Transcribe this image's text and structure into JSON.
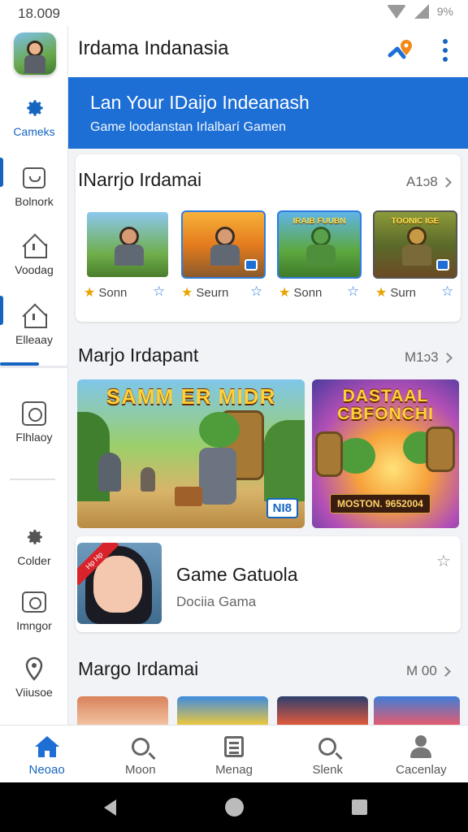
{
  "status": {
    "time": "18.009",
    "battery": "9%"
  },
  "app": {
    "title": "Irdama Indanasia"
  },
  "banner": {
    "title": "Lan Your IDaijo Indeanash",
    "subtitle": "Game loodanstan Irlalbarí Gamen"
  },
  "rail": {
    "items": [
      {
        "label": "Cameks",
        "icon": "gear-icon"
      },
      {
        "label": "Bolnork",
        "icon": "smile-box-icon"
      },
      {
        "label": "Voodag",
        "icon": "house-icon"
      },
      {
        "label": "Elleaay",
        "icon": "house-icon"
      },
      {
        "label": "Flhlaoy",
        "icon": "square-icon"
      },
      {
        "label": "Colder",
        "icon": "gear-icon"
      },
      {
        "label": "Imngor",
        "icon": "camera-icon"
      },
      {
        "label": "Viiusoe",
        "icon": "location-pin-icon"
      }
    ]
  },
  "section1": {
    "title": "INarrjo Irdamai",
    "more": "A1ɔ8",
    "tiles": [
      {
        "label": "Sonn",
        "caption": ""
      },
      {
        "label": "Seurn",
        "caption": ""
      },
      {
        "label": "Sonn",
        "caption": "IRAIB FUUBN"
      },
      {
        "label": "Surn",
        "caption": "TOONIC IGE"
      }
    ]
  },
  "section2": {
    "title": "Marjo Irdapant",
    "more": "M1ɔ3",
    "big_left": {
      "title": "SAMM ER MIDR",
      "badge": "NI8"
    },
    "big_right": {
      "title": "DASTAAL CBFONCHI",
      "badge": "MOSTON. 9652004"
    },
    "item": {
      "ribbon": "Hp Hp",
      "title": "Game Gatuola",
      "subtitle": "Dociia Gama"
    }
  },
  "section3": {
    "title": "Margo Irdamai",
    "more": "M 00"
  },
  "bottom_nav": {
    "items": [
      {
        "label": "Neoao",
        "icon": "home-icon"
      },
      {
        "label": "Moon",
        "icon": "search-icon"
      },
      {
        "label": "Menag",
        "icon": "document-icon"
      },
      {
        "label": "Slenk",
        "icon": "search-icon"
      },
      {
        "label": "Cacenlay",
        "icon": "person-icon"
      }
    ]
  },
  "colors": {
    "accent": "#1565c0",
    "banner": "#1d6fd6",
    "star": "#e8a400"
  }
}
